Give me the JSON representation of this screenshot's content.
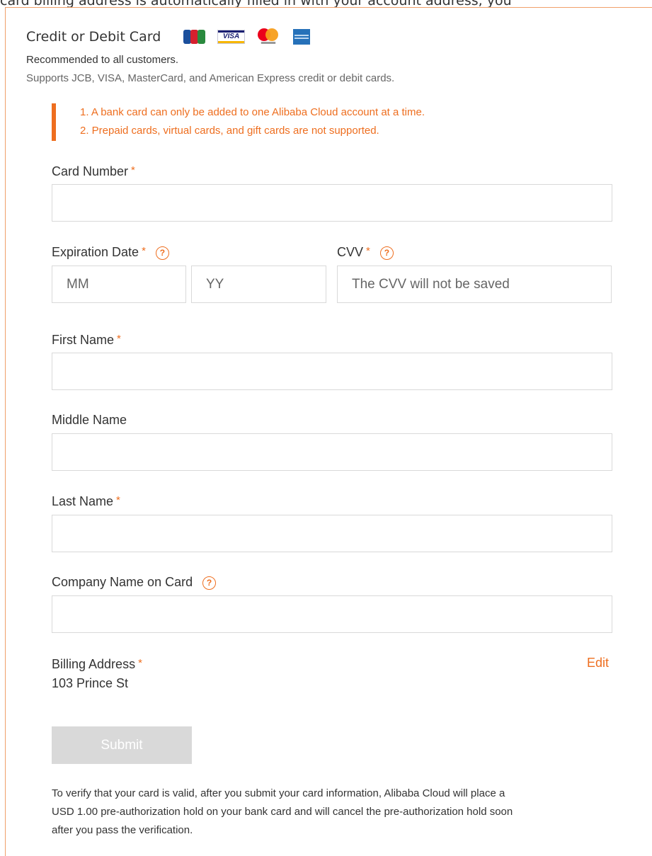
{
  "banner": {
    "text": "card billing address is automatically filled in with your account address, you"
  },
  "method": {
    "title": "Credit or Debit Card",
    "recommend": "Recommended to all customers.",
    "supports": "Supports JCB, VISA, MasterCard, and American Express credit or debit cards.",
    "logos": [
      {
        "icon": "jcb-logo-icon"
      },
      {
        "icon": "visa-logo-icon",
        "text": "VISA"
      },
      {
        "icon": "mastercard-logo-icon"
      },
      {
        "icon": "amex-logo-icon"
      }
    ]
  },
  "notice": {
    "lines": [
      "1. A bank card can only be added to one Alibaba Cloud account at a time.",
      "2. Prepaid cards, virtual cards, and gift cards are not supported."
    ]
  },
  "form": {
    "required_mark": "*",
    "help_glyph": "?",
    "card_number": {
      "label": "Card Number",
      "value": "",
      "placeholder": ""
    },
    "expiration": {
      "label": "Expiration Date",
      "month_placeholder": "MM",
      "year_placeholder": "YY"
    },
    "cvv": {
      "label": "CVV",
      "placeholder": "The CVV will not be saved"
    },
    "first_name": {
      "label": "First Name",
      "value": ""
    },
    "middle_name": {
      "label": "Middle Name",
      "value": ""
    },
    "last_name": {
      "label": "Last Name",
      "value": ""
    },
    "company_name": {
      "label": "Company Name on Card",
      "value": ""
    },
    "billing_address": {
      "label": "Billing Address",
      "value": "103 Prince St",
      "edit_label": "Edit"
    },
    "submit_label": "Submit"
  },
  "verify_note": {
    "lines": [
      "To verify that your card is valid, after you submit your card information, Alibaba Cloud will place a",
      "USD 1.00 pre-authorization hold on your bank card and will cancel the pre-authorization hold soon",
      "after you pass the verification."
    ]
  },
  "colors": {
    "accent": "#ee6e1f",
    "border": "#d9d9d9",
    "disabled_button": "#d9d9d9"
  }
}
